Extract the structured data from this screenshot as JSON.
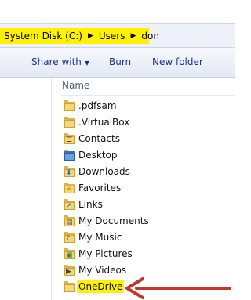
{
  "address": {
    "crumbs": [
      "System Disk (C:)",
      "Users",
      "don"
    ]
  },
  "toolbar": {
    "share_label": "Share with",
    "burn_label": "Burn",
    "new_folder_label": "New folder"
  },
  "columns": {
    "name_label": "Name"
  },
  "files": [
    {
      "name": ".pdfsam",
      "icon": "folder-icon"
    },
    {
      "name": ".VirtualBox",
      "icon": "folder-icon"
    },
    {
      "name": "Contacts",
      "icon": "contacts-folder-icon"
    },
    {
      "name": "Desktop",
      "icon": "desktop-folder-icon"
    },
    {
      "name": "Downloads",
      "icon": "downloads-folder-icon"
    },
    {
      "name": "Favorites",
      "icon": "favorites-folder-icon"
    },
    {
      "name": "Links",
      "icon": "links-folder-icon"
    },
    {
      "name": "My Documents",
      "icon": "documents-folder-icon"
    },
    {
      "name": "My Music",
      "icon": "music-folder-icon"
    },
    {
      "name": "My Pictures",
      "icon": "pictures-folder-icon"
    },
    {
      "name": "My Videos",
      "icon": "videos-folder-icon"
    },
    {
      "name": "OneDrive",
      "icon": "onedrive-folder-icon"
    }
  ],
  "colors": {
    "highlight": "#fff200",
    "arrow": "#c0392b",
    "toolbar_text": "#1e3287"
  }
}
